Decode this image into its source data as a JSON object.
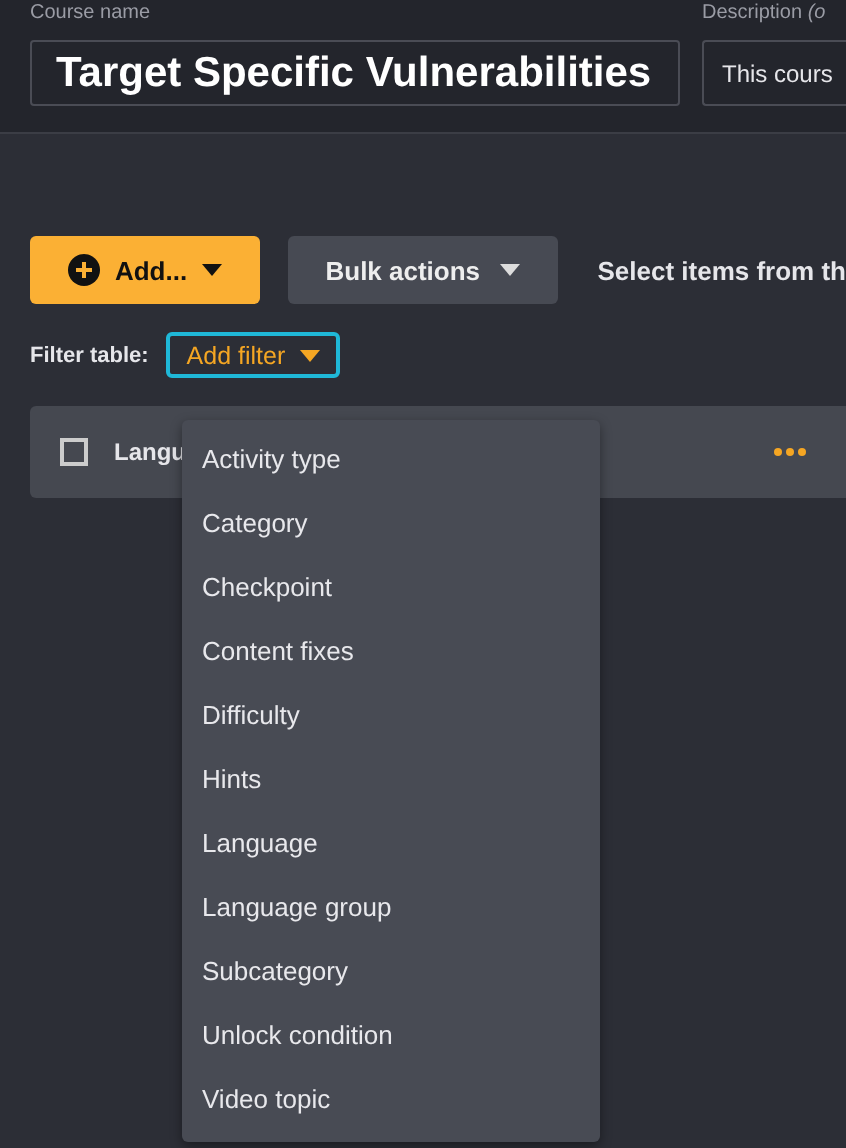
{
  "course_name": {
    "label": "Course name",
    "value": "Target Specific Vulnerabilities"
  },
  "description": {
    "label": "Description *(o*",
    "value": "This cours"
  },
  "toolbar": {
    "add_button": "Add...",
    "bulk_actions": "Bulk actions",
    "hint": "Select items from th"
  },
  "filter": {
    "label": "Filter table:",
    "button": "Add filter",
    "expanded": true
  },
  "table": {
    "header": {
      "checked": false,
      "column_1": "Langu"
    }
  },
  "filter_menu": [
    {
      "label": "Activity type"
    },
    {
      "label": "Category"
    },
    {
      "label": "Checkpoint"
    },
    {
      "label": "Content fixes"
    },
    {
      "label": "Difficulty"
    },
    {
      "label": "Hints"
    },
    {
      "label": "Language"
    },
    {
      "label": "Language group"
    },
    {
      "label": "Subcategory"
    },
    {
      "label": "Unlock condition"
    },
    {
      "label": "Video topic"
    }
  ]
}
